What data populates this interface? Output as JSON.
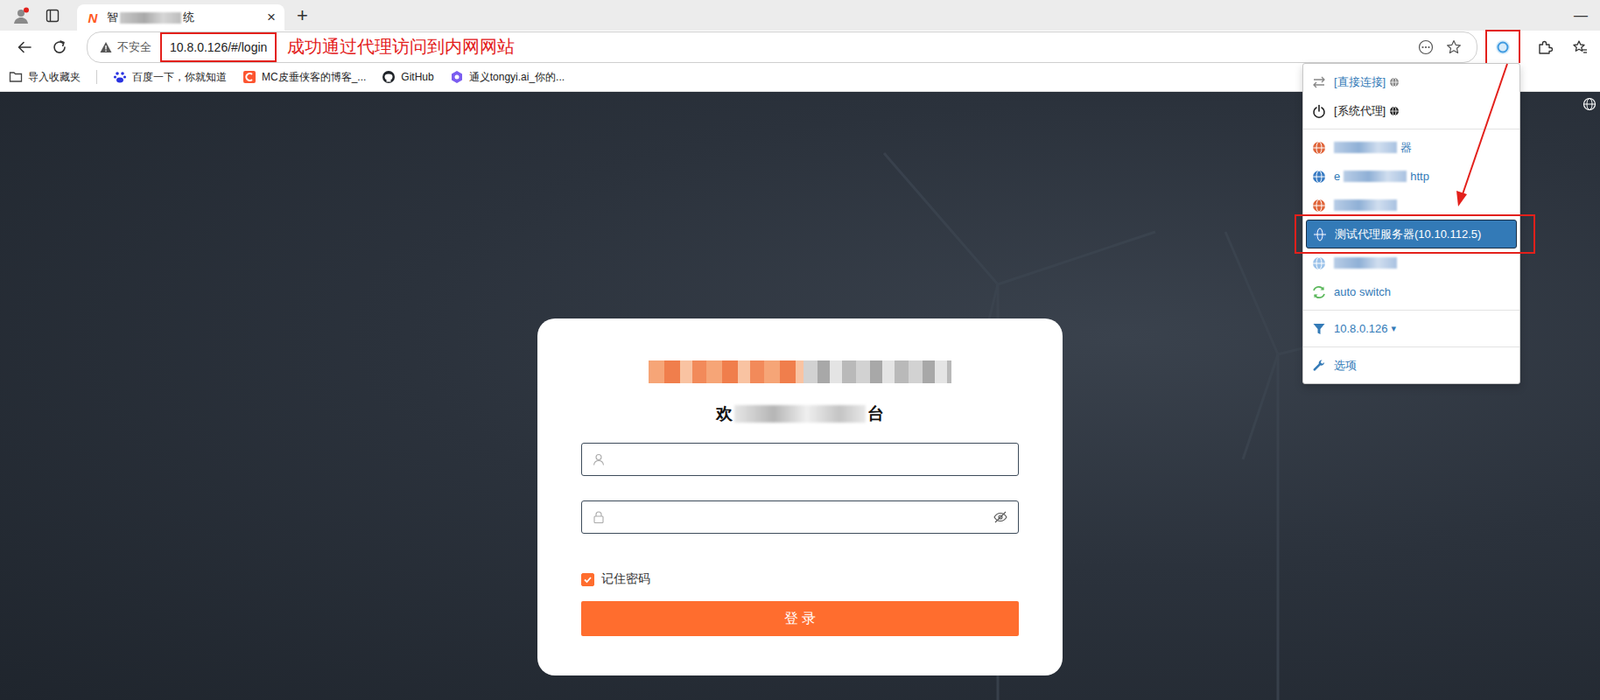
{
  "window": {
    "minimize": "—"
  },
  "tab": {
    "favicon": "N",
    "title_start": "智",
    "title_end": "统",
    "close": "×",
    "selected": true
  },
  "new_tab": "+",
  "address_bar": {
    "security": "不安全",
    "url": "10.8.0.126/#/login"
  },
  "annotation": {
    "text": "成功通过代理访问到内网网站"
  },
  "bookmarks": [
    {
      "label": "导入收藏夹",
      "color": "#444444"
    },
    {
      "label": "百度一下，你就知道",
      "color": "#2932e1"
    },
    {
      "label": "MC皮垂侠客的博客_...",
      "color": "#fc5531"
    },
    {
      "label": "GitHub",
      "color": "#1f2328"
    },
    {
      "label": "通义tongyi.ai_你的...",
      "color": "#7a5cf0"
    }
  ],
  "proxy_menu": {
    "groups": [
      [
        {
          "kind": "direct",
          "label": "[直接连接]",
          "blurred": false,
          "selected": false,
          "color": "#888888"
        },
        {
          "kind": "system",
          "label": "[系统代理]",
          "blurred": false,
          "selected": false,
          "color": "#222222"
        }
      ],
      [
        {
          "kind": "profile",
          "after": "器",
          "blurred": true,
          "selected": false,
          "color": "#e0663c"
        },
        {
          "kind": "profile",
          "before": "e",
          "after": "http",
          "blurred": true,
          "selected": false,
          "color": "#3b7dc4"
        },
        {
          "kind": "profile",
          "blurred": true,
          "selected": false,
          "color": "#e0663c"
        },
        {
          "kind": "profile",
          "label": "测试代理服务器(10.10.112.5)",
          "blurred": false,
          "selected": true,
          "color": "#3b7dc4"
        },
        {
          "kind": "profile",
          "blurred": true,
          "selected": false,
          "color": "#9dc3ea"
        },
        {
          "kind": "switch",
          "label": "auto switch",
          "blurred": false,
          "selected": false,
          "color": "#5cb85c"
        }
      ],
      [
        {
          "kind": "rule",
          "label": "10.8.0.126",
          "caret": "▾",
          "blurred": false,
          "selected": false,
          "color": "#337ab7"
        }
      ],
      [
        {
          "kind": "options",
          "label": "选项",
          "blurred": false,
          "selected": false,
          "color": "#337ab7"
        }
      ]
    ]
  },
  "login": {
    "greeting": {
      "start": "欢",
      "end": "台"
    },
    "remember": {
      "label": "记住密码",
      "checked": true
    },
    "button": "登 录"
  }
}
